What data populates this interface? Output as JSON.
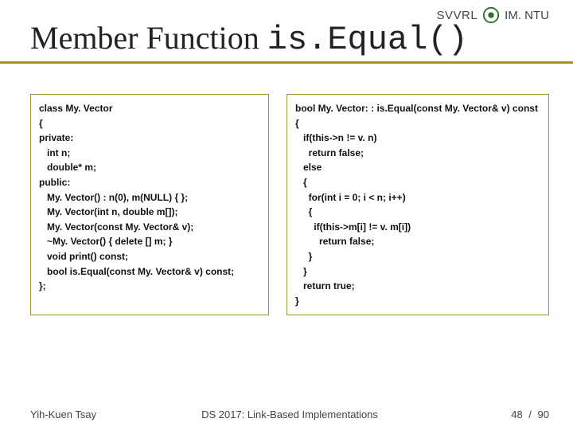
{
  "header": {
    "svvrl": "SVVRL",
    "at": "@",
    "imntu": "IM. NTU"
  },
  "title": {
    "prefix": "Member Function ",
    "code": "is.Equal()"
  },
  "code": {
    "left": "class My. Vector\n{\nprivate:\n   int n;\n   double* m;\npublic:\n   My. Vector() : n(0), m(NULL) { };\n   My. Vector(int n, double m[]);\n   My. Vector(const My. Vector& v);\n   ~My. Vector() { delete [] m; }\n   void print() const;\n   bool is.Equal(const My. Vector& v) const;\n};",
    "right": "bool My. Vector: : is.Equal(const My. Vector& v) const\n{\n   if(this->n != v. n)\n     return false;\n   else\n   {\n     for(int i = 0; i < n; i++)\n     {\n       if(this->m[i] != v. m[i])\n         return false;\n     }\n   }\n   return true;\n}"
  },
  "footer": {
    "author": "Yih-Kuen Tsay",
    "course": "DS 2017: Link-Based Implementations",
    "page_current": "48",
    "page_sep": " / ",
    "page_total": "90"
  }
}
